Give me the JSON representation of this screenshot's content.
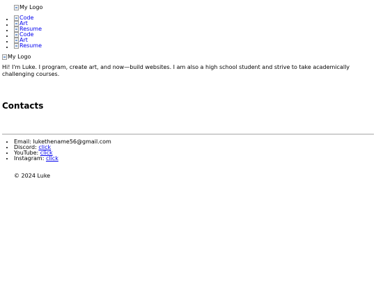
{
  "header": {
    "logo_alt": "My Logo"
  },
  "nav": {
    "items": [
      {
        "label": "Code"
      },
      {
        "label": "Art"
      },
      {
        "label": "Resume"
      },
      {
        "label": "Code"
      },
      {
        "label": "Art"
      },
      {
        "label": "Resume"
      }
    ]
  },
  "hero": {
    "logo_alt": "My Logo",
    "intro": "Hi! I'm Luke. I program, create art, and now—build websites. I am also a high school student and strive to take academically challenging courses."
  },
  "contacts": {
    "heading": "Contacts",
    "items": [
      {
        "label": "Email:",
        "value": "lukethename56@gmail.com"
      },
      {
        "label": "Discord:",
        "link": "click"
      },
      {
        "label": "YouTube:",
        "link": "click"
      },
      {
        "label": "Instagram:",
        "link": "click"
      }
    ]
  },
  "footer": {
    "text": "© 2024 Luke"
  },
  "colors": {
    "link": "#0000ee",
    "divider": "#b9b9b9"
  }
}
